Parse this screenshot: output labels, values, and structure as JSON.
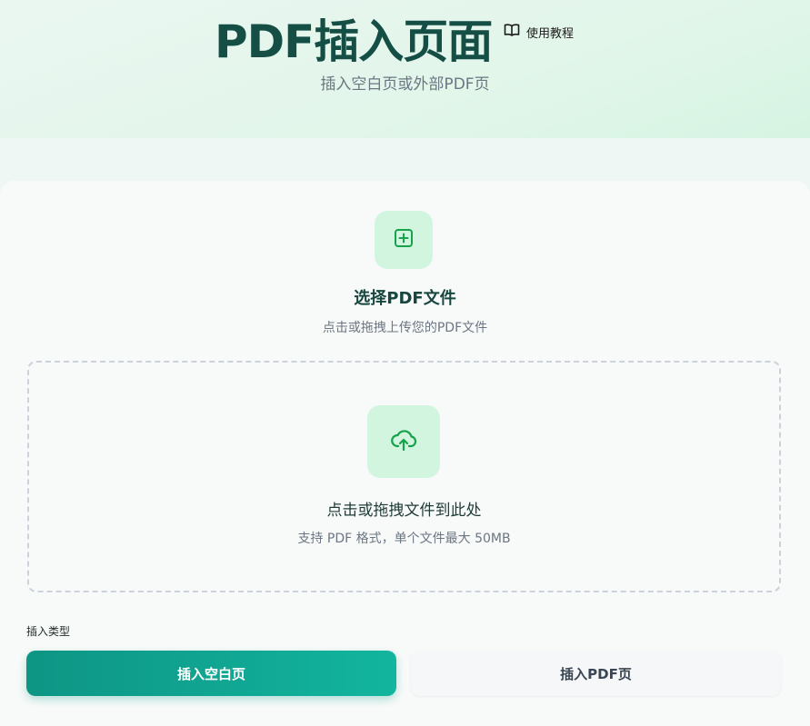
{
  "header": {
    "title": "PDF插入页面",
    "subtitle": "插入空白页或外部PDF页",
    "tutorial_label": "使用教程",
    "tutorial_icon": "book-open-icon"
  },
  "select_file": {
    "icon": "plus-square-icon",
    "title": "选择PDF文件",
    "subtitle": "点击或拖拽上传您的PDF文件"
  },
  "dropzone": {
    "icon": "cloud-upload-icon",
    "title": "点击或拖拽文件到此处",
    "hint": "支持 PDF 格式，单个文件最大 50MB"
  },
  "insert_type": {
    "label": "插入类型",
    "options": [
      {
        "label": "插入空白页",
        "selected": true
      },
      {
        "label": "插入PDF页",
        "selected": false
      }
    ]
  },
  "colors": {
    "accent": "#12a08e",
    "icon_green": "#16a34a",
    "icon_bg": "#d2f5df",
    "title_dark": "#144e45"
  }
}
